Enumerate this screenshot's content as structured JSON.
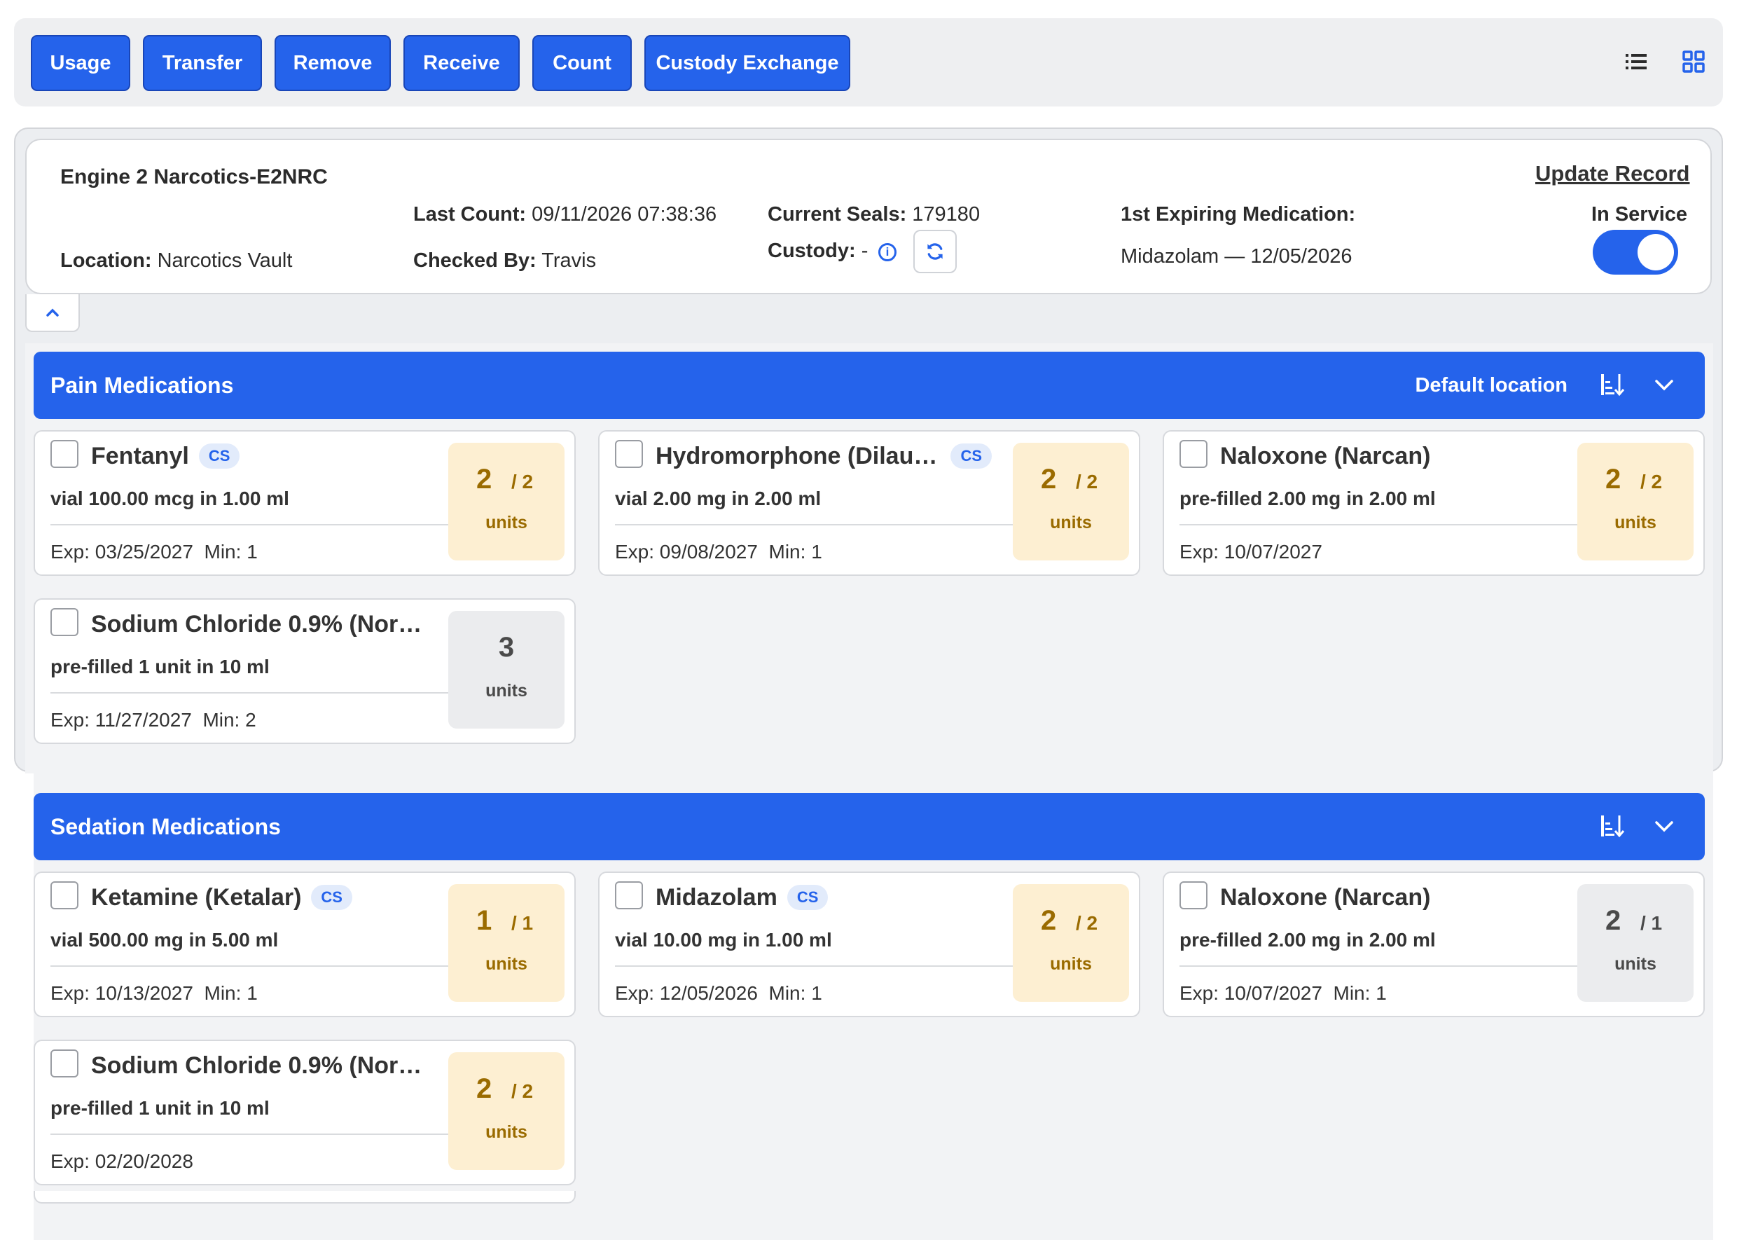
{
  "toolbar": {
    "buttons": [
      "Usage",
      "Transfer",
      "Remove",
      "Receive",
      "Count",
      "Custody Exchange"
    ],
    "list_view_icon": "list-view-icon",
    "grid_view_icon": "grid-view-icon"
  },
  "record": {
    "title": "Engine 2 Narcotics-E2NRC",
    "location_label": "Location:",
    "location_value": "Narcotics Vault",
    "last_count_label": "Last Count:",
    "last_count_value": "09/11/2026 07:38:36",
    "checked_by_label": "Checked By:",
    "checked_by_value": "Travis",
    "seals_label": "Current Seals:",
    "seals_value": "179180",
    "custody_label": "Custody:",
    "custody_value": "-",
    "expiring_label": "1st Expiring Medication:",
    "expiring_value": "Midazolam — 12/05/2026",
    "update_label": "Update Record",
    "status_label": "In Service",
    "in_service": true
  },
  "sections": [
    {
      "title": "Pain Medications",
      "location_label": "Default location",
      "items": [
        {
          "name": "Fentanyl",
          "cs": "CS",
          "form": "vial 100.00 mcg in 1.00 ml",
          "exp": "Exp: 03/25/2027",
          "min": "Min: 1",
          "qty": "2",
          "total": "/ 2",
          "unit": "units",
          "state": "warn"
        },
        {
          "name": "Hydromorphone (Dilaud...",
          "cs": "CS",
          "form": "vial 2.00 mg in 2.00 ml",
          "exp": "Exp: 09/08/2027",
          "min": "Min: 1",
          "qty": "2",
          "total": "/ 2",
          "unit": "units",
          "state": "warn"
        },
        {
          "name": "Naloxone (Narcan)",
          "cs": "",
          "form": "pre-filled 2.00 mg in 2.00 ml",
          "exp": "Exp: 10/07/2027",
          "min": "",
          "qty": "2",
          "total": "/ 2",
          "unit": "units",
          "state": "warn"
        },
        {
          "name": "Sodium Chloride 0.9% (Norm...",
          "cs": "",
          "form": "pre-filled 1 unit in 10 ml",
          "exp": "Exp: 11/27/2027",
          "min": "Min: 2",
          "qty": "3",
          "total": "",
          "unit": "units",
          "state": "ok"
        }
      ]
    },
    {
      "title": "Sedation Medications",
      "location_label": "",
      "items": [
        {
          "name": "Ketamine (Ketalar)",
          "cs": "CS",
          "form": "vial 500.00 mg in 5.00 ml",
          "exp": "Exp: 10/13/2027",
          "min": "Min: 1",
          "qty": "1",
          "total": "/ 1",
          "unit": "units",
          "state": "warn"
        },
        {
          "name": "Midazolam",
          "cs": "CS",
          "form": "vial 10.00 mg in 1.00 ml",
          "exp": "Exp: 12/05/2026",
          "min": "Min: 1",
          "qty": "2",
          "total": "/ 2",
          "unit": "units",
          "state": "warn"
        },
        {
          "name": "Naloxone (Narcan)",
          "cs": "",
          "form": "pre-filled 2.00 mg in 2.00 ml",
          "exp": "Exp: 10/07/2027",
          "min": "Min: 1",
          "qty": "2",
          "total": "/ 1",
          "unit": "units",
          "state": "ok"
        },
        {
          "name": "Sodium Chloride 0.9% (Norm...",
          "cs": "",
          "form": "pre-filled 1 unit in 10 ml",
          "exp": "Exp: 02/20/2028",
          "min": "",
          "qty": "2",
          "total": "/ 2",
          "unit": "units",
          "state": "warn"
        }
      ]
    }
  ],
  "colors": {
    "primary": "#2563eb",
    "warn_bg": "#fdefd2",
    "warn_text": "#9a6b00",
    "neutral_bg": "#ebecee",
    "cs_badge_bg": "#e2ebfb"
  }
}
